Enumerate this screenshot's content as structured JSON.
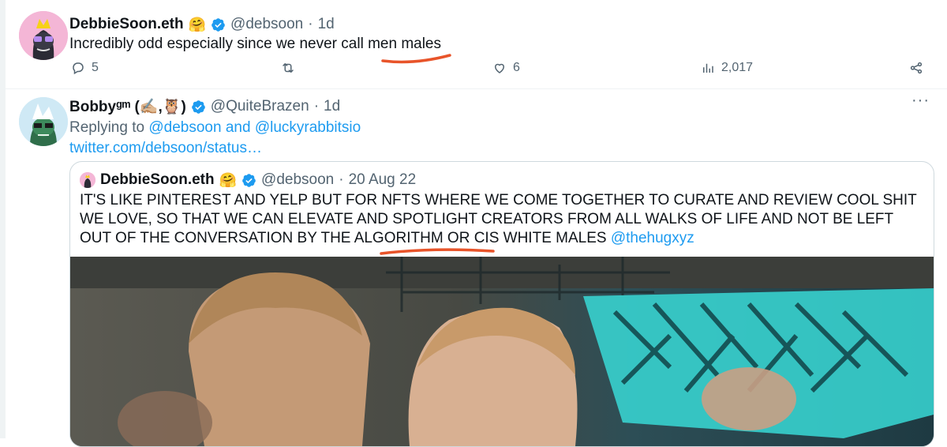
{
  "tweet1": {
    "display_name": "DebbieSoon.eth",
    "name_emoji": "🤗",
    "handle": "@debsoon",
    "separator": "·",
    "time": "1d",
    "text": "Incredibly odd especially since we never call men males",
    "reply_count": "5",
    "like_count": "6",
    "view_count": "2,017",
    "icons": [
      "reply-icon",
      "retweet-icon",
      "like-icon",
      "views-icon",
      "share-icon"
    ]
  },
  "tweet2": {
    "display_name": "Bobbyᵍᵐ (✍🏼,🦉)",
    "handle": "@QuiteBrazen",
    "separator": "·",
    "time": "1d",
    "replying_prefix": "Replying to",
    "replying_to_1": "@debsoon",
    "replying_and": "and",
    "replying_to_2": "@luckyrabbitsio",
    "status_link": "twitter.com/debsoon/status…",
    "more": "···",
    "quote": {
      "display_name": "DebbieSoon.eth",
      "name_emoji": "🤗",
      "handle": "@debsoon",
      "separator": "·",
      "date": "20 Aug 22",
      "text": "IT'S LIKE PINTEREST AND YELP BUT FOR NFTS WHERE WE COME TOGETHER TO CURATE AND REVIEW COOL SHIT WE LOVE, SO THAT WE CAN ELEVATE AND SPOTLIGHT CREATORS FROM ALL WALKS OF LIFE AND NOT BE LEFT OUT OF THE CONVERSATION BY THE ALGORITHM OR CIS WHITE MALES",
      "mention": "@thehugxyz"
    }
  },
  "colors": {
    "verified": "#1d9bf0",
    "link": "#1d9bf0",
    "muted": "#536471",
    "annotation": "#e8542a"
  }
}
